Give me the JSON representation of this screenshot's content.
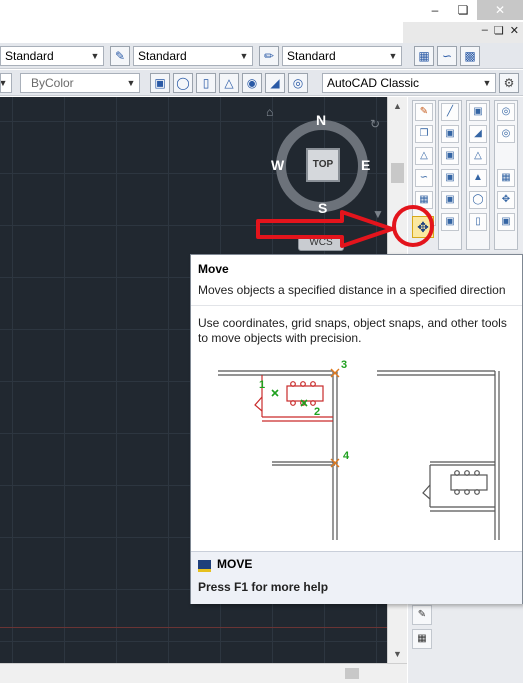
{
  "window": {
    "minimize": "–",
    "restore": "❏",
    "close": "✕",
    "inner_minimize": "–",
    "inner_restore": "❏",
    "inner_close": "✕"
  },
  "toolbar_row1": {
    "text_style": "Standard",
    "dim_style": "Standard",
    "table_style": "Standard"
  },
  "toolbar_row2": {
    "color_control": "ByColor",
    "workspace": "AutoCAD Classic"
  },
  "viewcube": {
    "top_face": "TOP",
    "north": "N",
    "south": "S",
    "east": "E",
    "west": "W",
    "ucs_menu": "WCS"
  },
  "tooltip": {
    "title": "Move",
    "description": "Moves objects a specified distance in a specified direction",
    "extended_text": "Use coordinates, grid snaps, object snaps, and other tools to move objects with precision.",
    "illustration_labels": [
      "1",
      "2",
      "3",
      "4"
    ],
    "command": "MOVE",
    "help_hint": "Press F1 for more help"
  },
  "colors": {
    "canvas_bg": "#212830",
    "annotation_red": "#e3141c",
    "pick_green": "#1fa01f",
    "snap_orange": "#e07a1e"
  },
  "icons": [
    "text-style-icon",
    "dim-style-icon",
    "table-style-icon",
    "multileader-style-icon",
    "viewcube-home-icon",
    "move-icon",
    "settings-gear-icon"
  ]
}
